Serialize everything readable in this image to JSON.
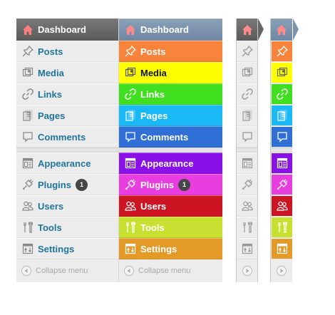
{
  "menu_default": {
    "dashboard": "Dashboard",
    "items_top": [
      "Posts",
      "Media",
      "Links",
      "Pages",
      "Comments"
    ],
    "items_bottom": [
      "Appearance",
      "Plugins",
      "Users",
      "Tools",
      "Settings"
    ],
    "plugins_badge": "1",
    "collapse": "Collapse menu"
  },
  "menu_colored": {
    "dashboard": "Dashboard",
    "items_top": [
      "Posts",
      "Media",
      "Links",
      "Pages",
      "Comments"
    ],
    "items_bottom": [
      "Appearance",
      "Plugins",
      "Users",
      "Tools",
      "Settings"
    ],
    "plugins_badge": "1",
    "collapse": "Collapse menu",
    "colors_top": [
      "#f7843a",
      "#ffff00",
      "#40e020",
      "#1ab8f5",
      "#2f6fd6"
    ],
    "colors_bottom": [
      "#8a10e8",
      "#e83ee0",
      "#cc1422",
      "#c8e030",
      "#e49a26"
    ]
  },
  "icons_top": [
    "posts-icon",
    "media-icon",
    "links-icon",
    "pages-icon",
    "comments-icon"
  ],
  "icons_bottom": [
    "appearance-icon",
    "plugins-icon",
    "users-icon",
    "tools-icon",
    "settings-icon"
  ]
}
